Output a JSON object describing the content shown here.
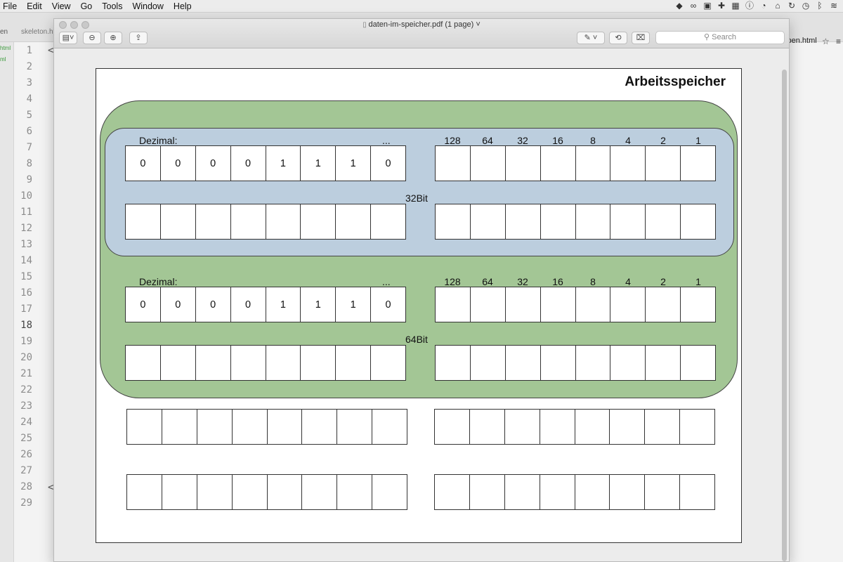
{
  "menubar": {
    "items": [
      "File",
      "Edit",
      "View",
      "Go",
      "Tools",
      "Window",
      "Help"
    ],
    "tray_icons": [
      "dropbox-icon",
      "creative-cloud-icon",
      "screen-recorder-icon",
      "plus-icon",
      "calendar-icon",
      "info-icon",
      "timer-icon",
      "lock-icon",
      "sync-icon",
      "clock-icon",
      "bluetooth-icon",
      "wifi-icon"
    ]
  },
  "editor": {
    "tab_left": "en",
    "tab_skeleton": "skeleton.htm",
    "tab_right": "ypen.html",
    "sidebar_files": [
      "html",
      "ml"
    ],
    "line_numbers": [
      "1",
      "2",
      "3",
      "4",
      "5",
      "6",
      "7",
      "8",
      "9",
      "10",
      "11",
      "12",
      "13",
      "14",
      "15",
      "16",
      "17",
      "18",
      "19",
      "20",
      "21",
      "22",
      "23",
      "24",
      "25",
      "26",
      "27",
      "28",
      "29"
    ],
    "active_line": "18",
    "code_frag": "<"
  },
  "preview": {
    "window_title": "daten-im-speicher.pdf (1 page)",
    "search_placeholder": "Search"
  },
  "document": {
    "title": "Arbeitsspeicher",
    "group_32": {
      "label": "32Bit",
      "decimal_label": "Dezimal:",
      "ellipsis": "...",
      "bit_weights": [
        "128",
        "64",
        "32",
        "16",
        "8",
        "4",
        "2",
        "1"
      ],
      "bits": [
        "0",
        "0",
        "0",
        "0",
        "1",
        "1",
        "1",
        "0"
      ]
    },
    "group_64": {
      "label": "64Bit",
      "decimal_label": "Dezimal:",
      "ellipsis": "...",
      "bit_weights": [
        "128",
        "64",
        "32",
        "16",
        "8",
        "4",
        "2",
        "1"
      ],
      "bits": [
        "0",
        "0",
        "0",
        "0",
        "1",
        "1",
        "1",
        "0"
      ]
    }
  }
}
